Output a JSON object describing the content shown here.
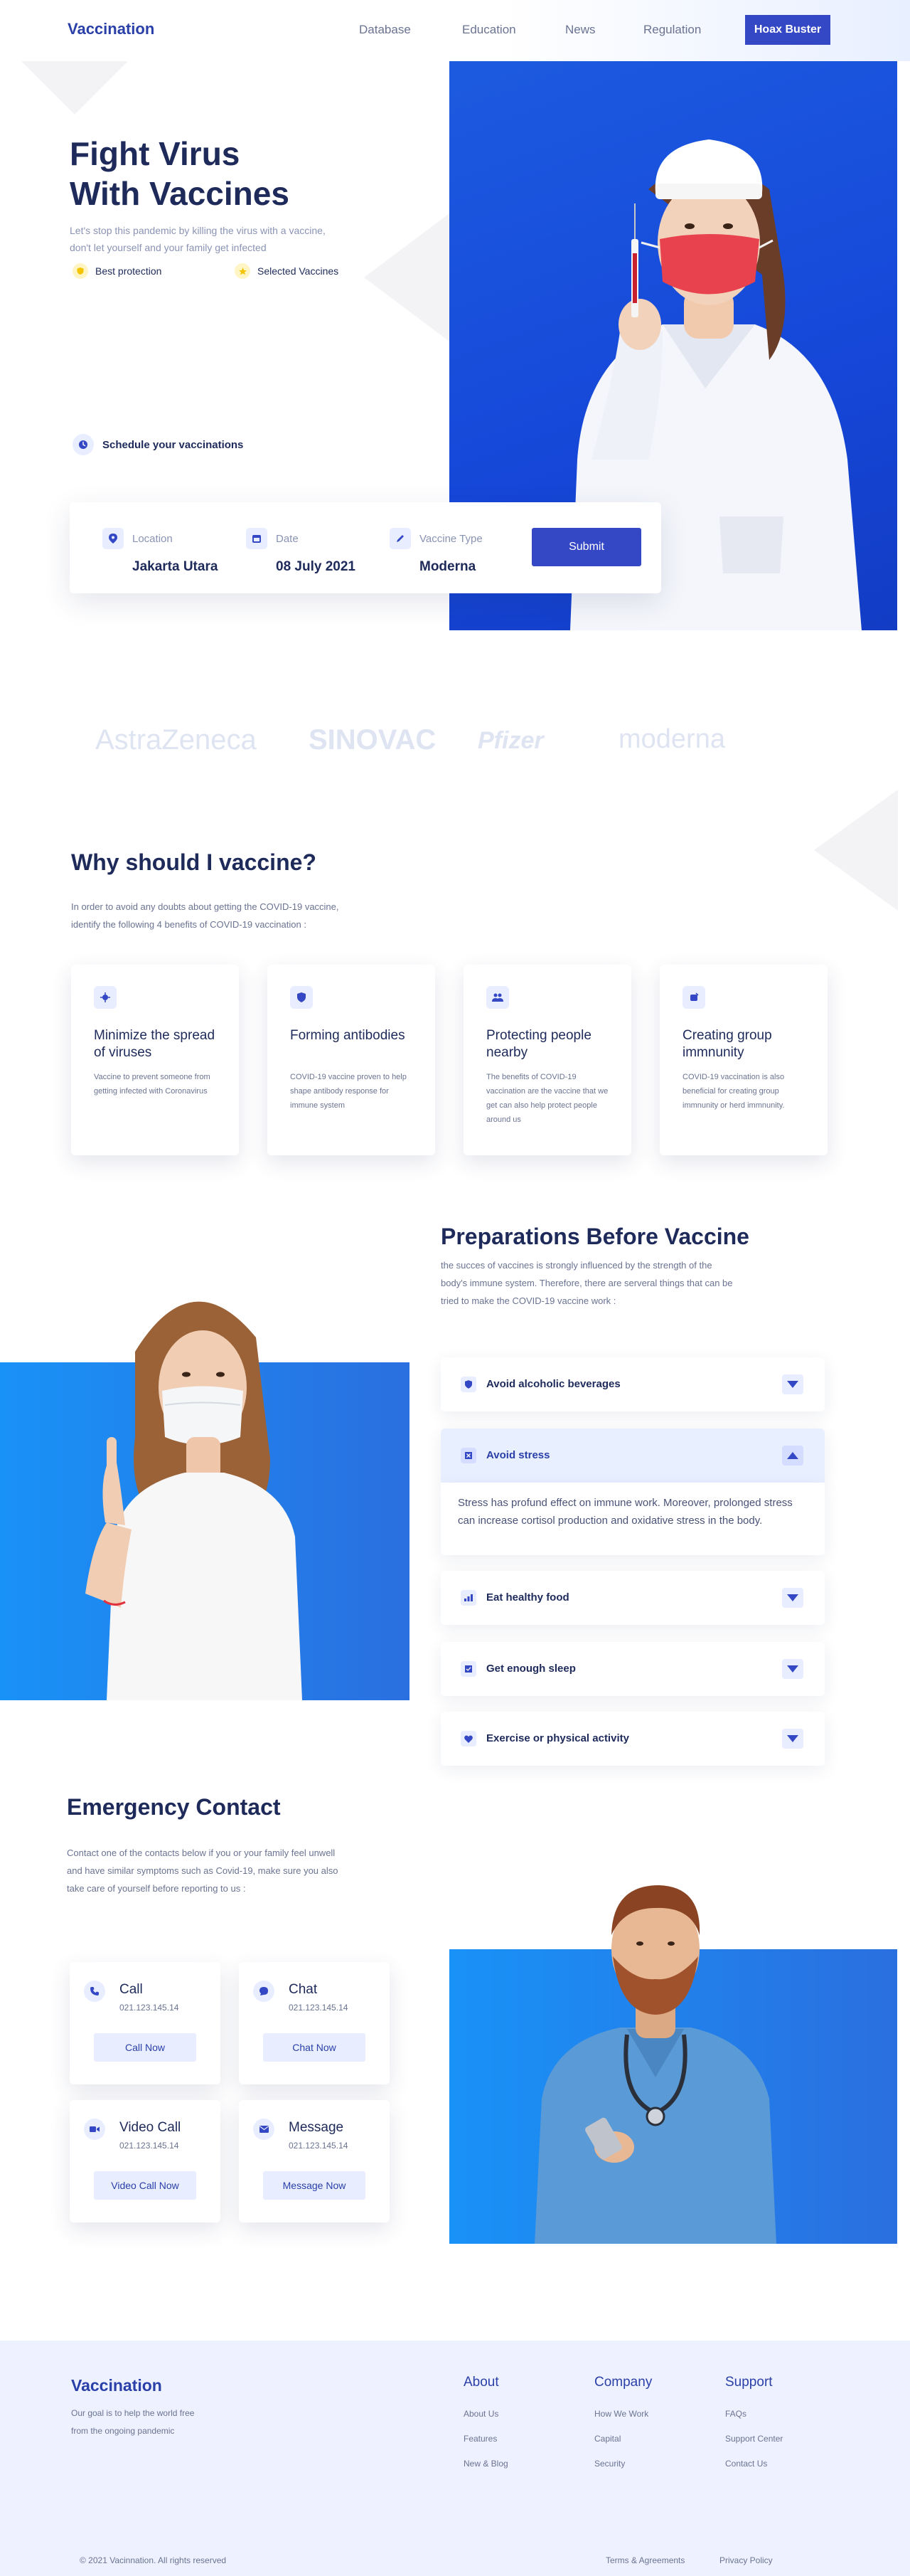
{
  "nav": {
    "brand": "Vaccination",
    "links": [
      "Database",
      "Education",
      "News",
      "Regulation"
    ],
    "cta": "Hoax Buster"
  },
  "hero": {
    "title_line1": "Fight Virus",
    "title_line2": "With Vaccines",
    "description": "Let's stop this pandemic by killing the virus with a vaccine, don't let yourself and your family get infected",
    "badges": [
      "Best protection",
      "Selected Vaccines"
    ],
    "schedule": "Schedule your vaccinations"
  },
  "search": {
    "location_label": "Location",
    "location_value": "Jakarta Utara",
    "date_label": "Date",
    "date_value": "08 July 2021",
    "vaccine_label": "Vaccine Type",
    "vaccine_value": "Moderna",
    "submit": "Submit"
  },
  "brands": [
    "AstraZeneca",
    "SINOVAC",
    "Pfizer",
    "moderna"
  ],
  "why": {
    "title": "Why should I vaccine?",
    "description": "In order to avoid any doubts about getting the COVID-19 vaccine, identify the following 4 benefits of COVID-19 vaccination :",
    "cards": [
      {
        "title": "Minimize the spread of viruses",
        "desc": "Vaccine to prevent someone from getting infected with Coronavirus"
      },
      {
        "title": "Forming antibodies",
        "desc": "COVID-19 vaccine proven to help shape antibody response for immune system"
      },
      {
        "title": "Protecting people nearby",
        "desc": "The benefits of COVID-19 vaccination are the vaccine that we get can also help protect people around us"
      },
      {
        "title": "Creating group immnunity",
        "desc": "COVID-19 vaccination is also beneficial for creating group immnunity or herd immnunity."
      }
    ]
  },
  "prep": {
    "title": "Preparations Before Vaccine",
    "description": "the succes of vaccines is strongly influenced by the strength of the body's immune system. Therefore, there are serveral things that can be tried to make the COVID-19 vaccine work :",
    "items": [
      "Avoid alcoholic beverages",
      "Avoid stress",
      "Eat healthy food",
      "Get enough sleep",
      "Exercise or physical activity"
    ],
    "active_body": "Stress has profund effect on immune work. Moreover, prolonged stress can increase cortisol production and oxidative stress in the body."
  },
  "emergency": {
    "title": "Emergency Contact",
    "description": "Contact one of the contacts below if you or your family feel unwell and have similar symptoms such as Covid-19, make sure you also take care of yourself before reporting to us :",
    "contacts": [
      {
        "title": "Call",
        "number": "021.123.145.14",
        "button": "Call Now"
      },
      {
        "title": "Chat",
        "number": "021.123.145.14",
        "button": "Chat Now"
      },
      {
        "title": "Video Call",
        "number": "021.123.145.14",
        "button": "Video Call Now"
      },
      {
        "title": "Message",
        "number": "021.123.145.14",
        "button": "Message Now"
      }
    ]
  },
  "footer": {
    "brand": "Vaccination",
    "description": "Our goal is to help the world free from the ongoing pandemic",
    "columns": [
      {
        "title": "About",
        "links": [
          "About Us",
          "Features",
          "New & Blog"
        ]
      },
      {
        "title": "Company",
        "links": [
          "How We Work",
          "Capital",
          "Security"
        ]
      },
      {
        "title": "Support",
        "links": [
          "FAQs",
          "Support Center",
          "Contact Us"
        ]
      }
    ],
    "copyright": "© 2021 Vacinnation. All rights reserved",
    "legal": [
      "Terms & Agreements",
      "Privacy Policy"
    ]
  },
  "colors": {
    "primary": "#3448c5",
    "navy": "#1e2a5a",
    "accent_blue": "#1647d8",
    "soft_blue": "#e8edff",
    "muted_text": "#6a7391"
  }
}
